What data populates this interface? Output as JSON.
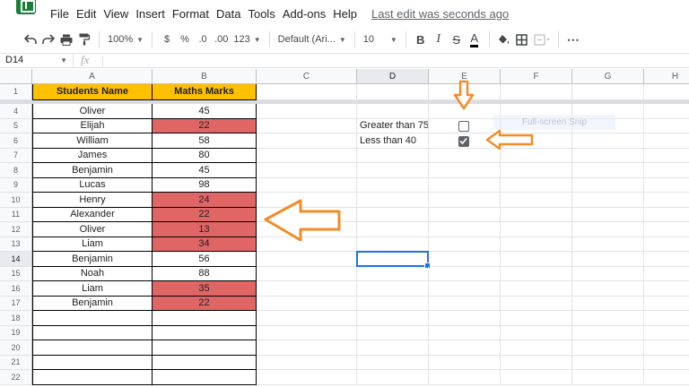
{
  "menu": {
    "items": [
      "File",
      "Edit",
      "View",
      "Insert",
      "Format",
      "Data",
      "Tools",
      "Add-ons",
      "Help"
    ],
    "last_edit": "Last edit was seconds ago"
  },
  "toolbar": {
    "zoom": "100%",
    "currency": "$",
    "percent": "%",
    "dec_decrease": ".0",
    "dec_increase": ".00",
    "more_formats": "123",
    "font": "Default (Ari...",
    "font_size": "10",
    "bold": "B",
    "italic": "I",
    "strike": "S",
    "text_color": "A",
    "more": "⋯"
  },
  "formula_bar": {
    "cell_ref": "D14",
    "fx": "fx",
    "value": ""
  },
  "columns": [
    "A",
    "B",
    "C",
    "D",
    "E",
    "F",
    "G",
    "H"
  ],
  "header_row": {
    "row": "1",
    "a": "Students Name",
    "b": "Maths Marks"
  },
  "rows": [
    {
      "num": "4",
      "name": "Oliver",
      "mark": "45",
      "red": false
    },
    {
      "num": "5",
      "name": "Elijah",
      "mark": "22",
      "red": true
    },
    {
      "num": "6",
      "name": "William",
      "mark": "58",
      "red": false
    },
    {
      "num": "7",
      "name": "James",
      "mark": "80",
      "red": false
    },
    {
      "num": "8",
      "name": "Benjamin",
      "mark": "45",
      "red": false
    },
    {
      "num": "9",
      "name": "Lucas",
      "mark": "98",
      "red": false
    },
    {
      "num": "10",
      "name": "Henry",
      "mark": "24",
      "red": true
    },
    {
      "num": "11",
      "name": "Alexander",
      "mark": "22",
      "red": true
    },
    {
      "num": "12",
      "name": "Oliver",
      "mark": "13",
      "red": true
    },
    {
      "num": "13",
      "name": "Liam",
      "mark": "34",
      "red": true
    },
    {
      "num": "14",
      "name": "Benjamin",
      "mark": "56",
      "red": false
    },
    {
      "num": "15",
      "name": "Noah",
      "mark": "88",
      "red": false
    },
    {
      "num": "16",
      "name": "Liam",
      "mark": "35",
      "red": true
    },
    {
      "num": "17",
      "name": "Benjamin",
      "mark": "22",
      "red": true
    },
    {
      "num": "18",
      "name": "",
      "mark": "",
      "red": false
    },
    {
      "num": "19",
      "name": "",
      "mark": "",
      "red": false
    },
    {
      "num": "20",
      "name": "",
      "mark": "",
      "red": false
    },
    {
      "num": "21",
      "name": "",
      "mark": "",
      "red": false
    },
    {
      "num": "22",
      "name": "",
      "mark": "",
      "red": false
    }
  ],
  "criteria": [
    {
      "label": "Greater than 75",
      "checked": false
    },
    {
      "label": "Less than 40",
      "checked": true
    }
  ],
  "colors": {
    "header_fill": "#ffc000",
    "highlight_fill": "#e06666",
    "arrow": "#f28c28",
    "selection": "#1a73e8"
  },
  "watermark": "Full-screen Snip"
}
